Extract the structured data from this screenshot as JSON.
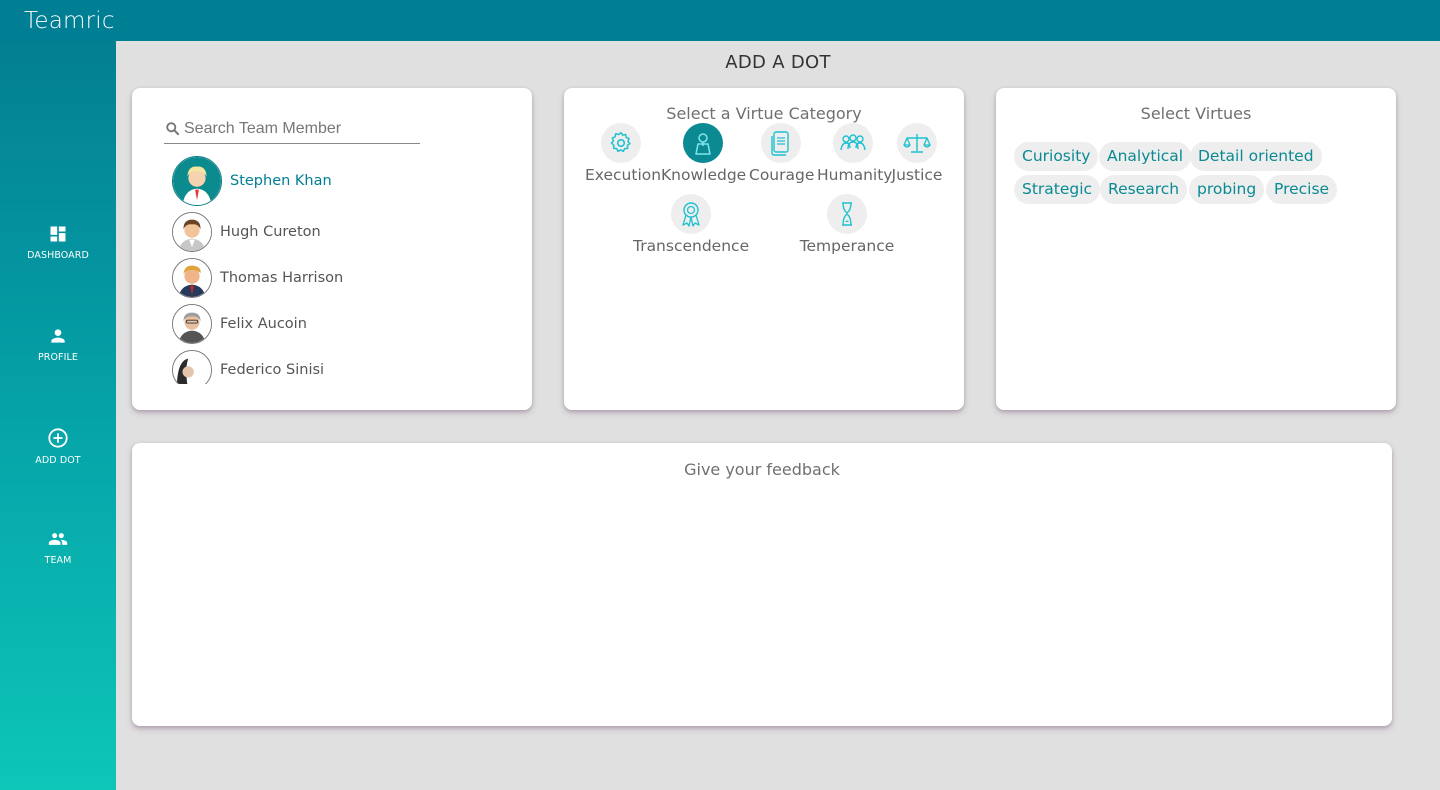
{
  "app": {
    "brand": "Teamric"
  },
  "sidebar": {
    "items": [
      {
        "label": "DASHBOARD",
        "icon": "dashboard-icon"
      },
      {
        "label": "PROFILE",
        "icon": "person-icon"
      },
      {
        "label": "ADD DOT",
        "icon": "add-circle-icon"
      },
      {
        "label": "TEAM",
        "icon": "group-icon"
      }
    ]
  },
  "page": {
    "title": "ADD A DOT"
  },
  "members_card": {
    "search_placeholder": "Search Team Member",
    "search_value": "",
    "members": [
      {
        "name": "Stephen Khan",
        "selected": true
      },
      {
        "name": "Hugh Cureton",
        "selected": false
      },
      {
        "name": "Thomas Harrison",
        "selected": false
      },
      {
        "name": "Felix Aucoin",
        "selected": false
      },
      {
        "name": "Federico Sinisi",
        "selected": false
      }
    ]
  },
  "category_card": {
    "title": "Select a Virtue Category",
    "categories": [
      {
        "label": "Execution",
        "icon": "gear-icon",
        "active": false
      },
      {
        "label": "Knowledge",
        "icon": "knowledge-icon",
        "active": true
      },
      {
        "label": "Courage",
        "icon": "document-icon",
        "active": false
      },
      {
        "label": "Humanity",
        "icon": "people-icon",
        "active": false
      },
      {
        "label": "Justice",
        "icon": "scales-icon",
        "active": false
      },
      {
        "label": "Transcendence",
        "icon": "award-icon",
        "active": false
      },
      {
        "label": "Temperance",
        "icon": "hourglass-icon",
        "active": false
      }
    ]
  },
  "virtues_card": {
    "title": "Select Virtues",
    "virtues": [
      "Curiosity",
      "Analytical",
      "Detail oriented",
      "Strategic",
      "Research",
      "probing",
      "Precise"
    ]
  },
  "feedback_card": {
    "title": "Give your feedback",
    "value": ""
  },
  "colors": {
    "topbar": "#007e93",
    "accent": "#0a8a93",
    "active_category": "#0b8a94",
    "icon_teal": "#1fc0cf",
    "background": "#e0e0e0"
  }
}
